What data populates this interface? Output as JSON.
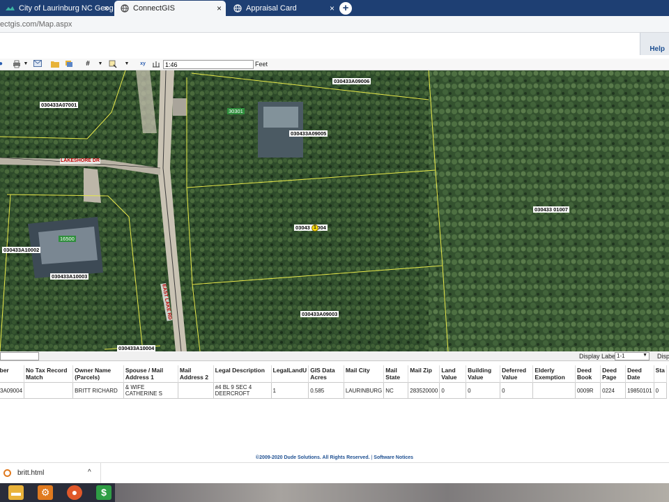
{
  "browser": {
    "tabs": [
      {
        "label": "City of Laurinburg NC Geographi",
        "close": "×",
        "active": false
      },
      {
        "label": "ConnectGIS",
        "close": "×",
        "active": true
      },
      {
        "label": "Appraisal Card",
        "close": "×",
        "active": false
      }
    ],
    "new_tab": "+",
    "url": "ectgis.com/Map.aspx"
  },
  "header": {
    "help": "Help"
  },
  "toolbar": {
    "scale_value": "1:46",
    "scale_unit": "Feet"
  },
  "map": {
    "parcels": [
      {
        "id": "030433A09006"
      },
      {
        "id": "030433A07001"
      },
      {
        "id": "030433A09005"
      },
      {
        "id": "030433 01007"
      },
      {
        "id": "03043 09004"
      },
      {
        "id": "030433A10002"
      },
      {
        "id": "030433A10003"
      },
      {
        "id": "030433A09003"
      },
      {
        "id": "030433A10004"
      }
    ],
    "addresses": [
      "30301",
      "16500"
    ],
    "streets": [
      "LAKESHORE DR",
      "EAST LAKE RD"
    ],
    "pin": "1"
  },
  "panel": {
    "display_labels": "Display Labels",
    "display_labels_value": "1-1",
    "disp_truncated": "Disp"
  },
  "table": {
    "headers": [
      "ber",
      "No Tax Record Match",
      "Owner Name (Parcels)",
      "Spouse / Mail Address 1",
      "Mail Address 2",
      "Legal Description",
      "LegalLandU",
      "GIS Data Acres",
      "Mail City",
      "Mail State",
      "Mail Zip",
      "Land Value",
      "Building Value",
      "Deferred Value",
      "Elderly Exemption",
      "Deed Book",
      "Deed Page",
      "Deed Date",
      "Sta"
    ],
    "rows": [
      [
        "3A09004",
        "",
        "BRITT RICHARD",
        "& WIFE CATHERINE S",
        "",
        "#4 BL 9 SEC 4 DEERCROFT",
        "1",
        "0.585",
        "LAURINBURG",
        "NC",
        "283520000",
        "0",
        "0",
        "0",
        "",
        "0009R",
        "0224",
        "19850101",
        "0"
      ]
    ]
  },
  "footer": {
    "copyright": "©2009-2020 Dude Solutions. All Rights Reserved.",
    "separator": "|",
    "notices": "Software Notices"
  },
  "downloads": {
    "file": "britt.html",
    "chevron": "^"
  },
  "colors": {
    "tabbar": "#1e3f73",
    "parcel_line": "#e8e84a",
    "link": "#1d4f91",
    "address_badge": "#2f8e3c",
    "street": "#b00000"
  }
}
